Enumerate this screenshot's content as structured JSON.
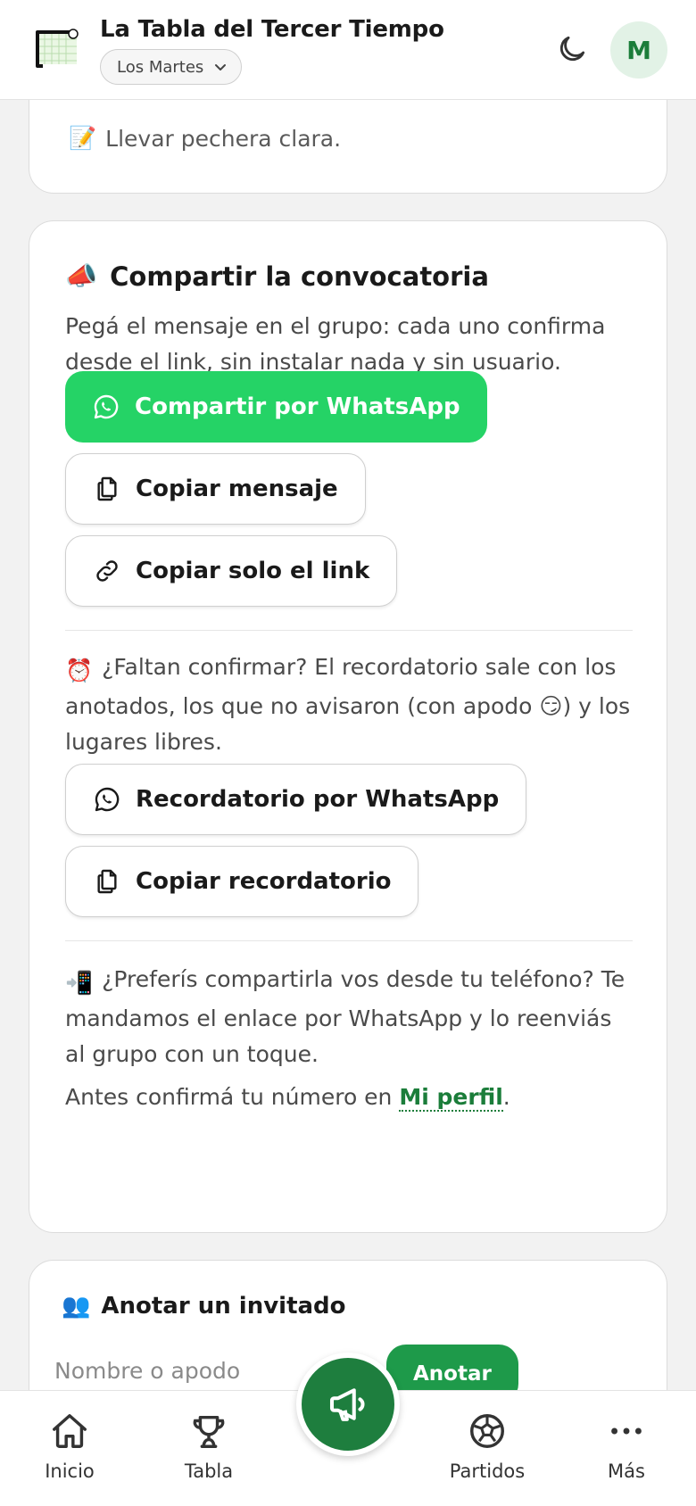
{
  "header": {
    "title": "La Tabla del Tercer Tiempo",
    "group_selector": "Los Martes",
    "theme_icon": "moon-icon",
    "avatar_initial": "M"
  },
  "notes_card": {
    "note_emoji": "📝",
    "note_text": "Llevar pechera clara."
  },
  "share_card": {
    "title_emoji": "📣",
    "title": "Compartir la convocatoria",
    "description": "Pegá el mensaje en el grupo: cada uno confirma desde el link, sin instalar nada y sin usuario.",
    "buttons": {
      "whatsapp": "Compartir por WhatsApp",
      "copy_message": "Copiar mensaje",
      "copy_link": "Copiar solo el link"
    },
    "reminder": {
      "emoji": "⏰",
      "text_before": "¿Faltan confirmar? El recordatorio sale con los anotados, los que no avisaron (con apodo ",
      "inline_emoji": "😏",
      "text_after": ") y los lugares libres.",
      "whatsapp_button": "Recordatorio por WhatsApp",
      "copy_button": "Copiar recordatorio"
    },
    "phone": {
      "emoji": "📲",
      "text": "¿Preferís compartirla vos desde tu teléfono? Te mandamos el enlace por WhatsApp y lo reenviás al grupo con un toque.",
      "confirm_before": "Antes confirmá tu número en ",
      "confirm_link": "Mi perfil",
      "confirm_after": "."
    }
  },
  "invite_card": {
    "emoji": "👥",
    "title": "Anotar un invitado",
    "input_placeholder": "Nombre o apodo",
    "submit_button": "Anotar"
  },
  "bottom_nav": {
    "items": [
      {
        "label": "Inicio",
        "icon": "home-icon"
      },
      {
        "label": "Tabla",
        "icon": "trophy-icon"
      },
      {
        "label": "Partidos",
        "icon": "soccer-ball-icon"
      },
      {
        "label": "Más",
        "icon": "more-icon"
      }
    ],
    "fab_icon": "megaphone-icon"
  },
  "colors": {
    "whatsapp_green": "#25d366",
    "brand_green": "#1e7e3e",
    "link_green": "#1b7d3a"
  }
}
